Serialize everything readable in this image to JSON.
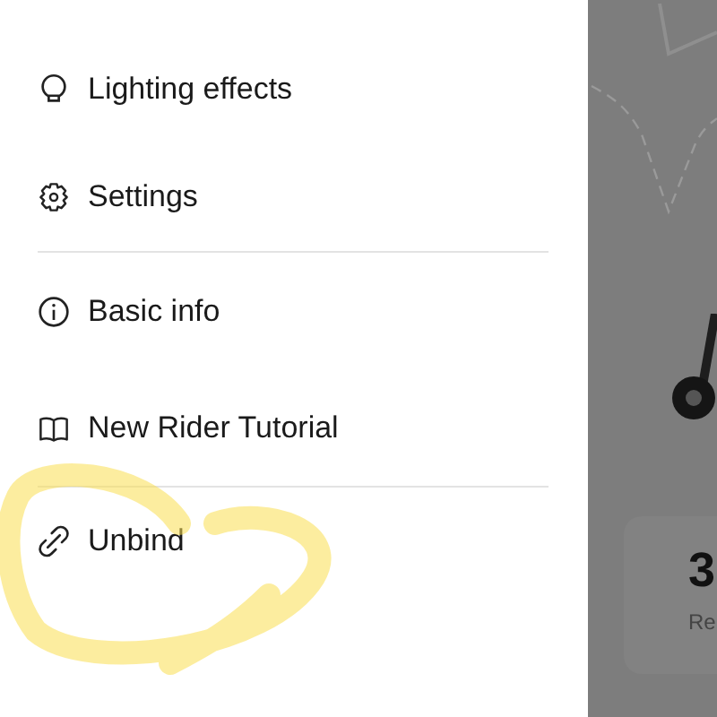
{
  "menu": {
    "sections": [
      [
        {
          "kind": "light",
          "label": "Lighting effects"
        },
        {
          "kind": "settings",
          "label": "Settings"
        }
      ],
      [
        {
          "kind": "info",
          "label": "Basic info"
        },
        {
          "kind": "tutorial",
          "label": "New Rider Tutorial"
        }
      ],
      [
        {
          "kind": "unbind",
          "label": "Unbind"
        }
      ]
    ]
  },
  "background": {
    "stat_card": {
      "value": "3",
      "label": "Re"
    }
  }
}
